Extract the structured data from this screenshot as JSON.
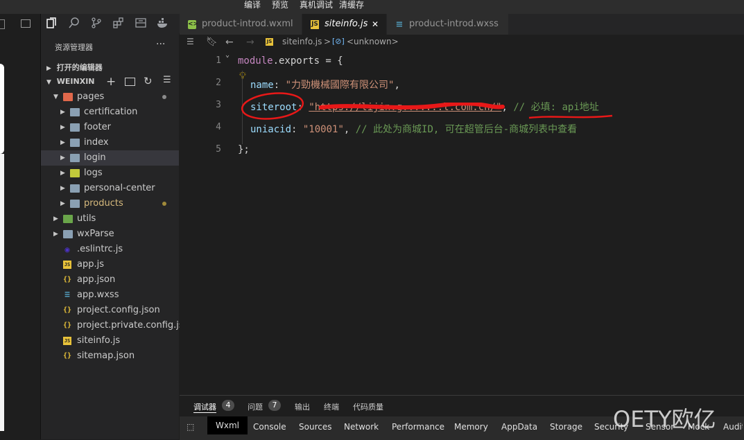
{
  "top_menu": [
    "编译",
    "预览",
    "真机调试",
    "清缓存"
  ],
  "explorer": {
    "title": "资源管理器",
    "more": "···",
    "open_editors": "打开的编辑器",
    "workspace": "WEINXIN"
  },
  "tree": [
    {
      "label": "pages",
      "kind": "folder-open",
      "depth": 1,
      "dot": "#8b8b8b"
    },
    {
      "label": "certification",
      "kind": "folder",
      "depth": 2
    },
    {
      "label": "footer",
      "kind": "folder",
      "depth": 2
    },
    {
      "label": "index",
      "kind": "folder",
      "depth": 2
    },
    {
      "label": "login",
      "kind": "folder",
      "depth": 2,
      "selected": true
    },
    {
      "label": "logs",
      "kind": "folder",
      "depth": 2
    },
    {
      "label": "personal-center",
      "kind": "folder",
      "depth": 2
    },
    {
      "label": "products",
      "kind": "folder",
      "depth": 2,
      "modified": true,
      "dot": "#a08a3a"
    },
    {
      "label": "utils",
      "kind": "folder",
      "depth": 1
    },
    {
      "label": "wxParse",
      "kind": "folder",
      "depth": 1
    },
    {
      "label": ".eslintrc.js",
      "kind": "eslint",
      "depth": 1
    },
    {
      "label": "app.js",
      "kind": "js",
      "depth": 1
    },
    {
      "label": "app.json",
      "kind": "json",
      "depth": 1
    },
    {
      "label": "app.wxss",
      "kind": "css",
      "depth": 1
    },
    {
      "label": "project.config.json",
      "kind": "json",
      "depth": 1
    },
    {
      "label": "project.private.config.js...",
      "kind": "json",
      "depth": 1
    },
    {
      "label": "siteinfo.js",
      "kind": "js",
      "depth": 1
    },
    {
      "label": "sitemap.json",
      "kind": "json",
      "depth": 1
    }
  ],
  "tabs": [
    {
      "label": "product-introd.wxml",
      "icon": "wxml"
    },
    {
      "label": "siteinfo.js",
      "icon": "js",
      "active": true,
      "close": "✕"
    },
    {
      "label": "product-introd.wxss",
      "icon": "css"
    }
  ],
  "breadcrumb": {
    "file": "siteinfo.js",
    "sep": ">",
    "symbol": "<unknown>"
  },
  "code": {
    "line_numbers": [
      "1",
      "2",
      "3",
      "4",
      "5"
    ],
    "l1_kw": "module",
    "l1_rest": ".exports = {",
    "l2_key": "name",
    "l2_colon": ": ",
    "l2_str": "\"力勁機械國際有限公司\"",
    "l2_comma": ",",
    "l3_key": "siteroot",
    "l3_colon": ": ",
    "l3_str": "\"https://lijin.g.......l.com.cn/\"",
    "l3_comma": ", ",
    "l3_comment": "// 必填: api地址",
    "l4_key": "uniacid",
    "l4_colon": ": ",
    "l4_str": "\"10001\"",
    "l4_comma": ", ",
    "l4_comment": "// 此处为商城ID, 可在超管后台-商城列表中查看",
    "l5": "};"
  },
  "panel": {
    "tabs": [
      {
        "label": "调试器",
        "badge": "4"
      },
      {
        "label": "问题",
        "badge": "7"
      },
      {
        "label": "输出"
      },
      {
        "label": "终端"
      },
      {
        "label": "代码质量"
      }
    ],
    "devtools": [
      "Wxml",
      "Console",
      "Sources",
      "Network",
      "Performance",
      "Memory",
      "AppData",
      "Storage",
      "Security",
      "Sensor",
      "Mock",
      "Audits"
    ]
  },
  "watermark": "OETY欧亿"
}
